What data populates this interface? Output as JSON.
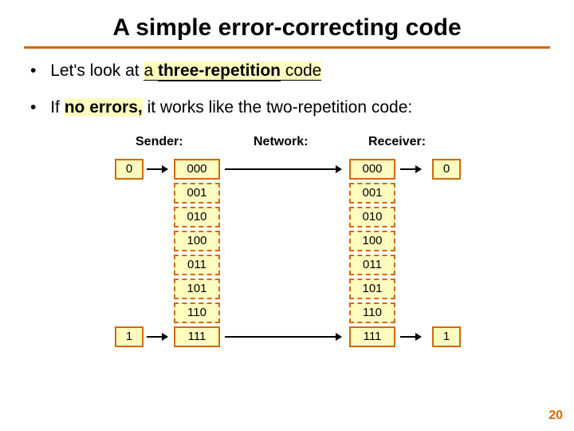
{
  "title": "A simple error-correcting code",
  "bullets": {
    "b1_pre": "Let's look at ",
    "b1_a": "a ",
    "b1_u": "three-repetition",
    "b1_post": " code",
    "b2_pre": "If ",
    "b2_no_errors": "no errors,",
    "b2_post": " it works like the two-repetition code:"
  },
  "headers": {
    "sender": "Sender:",
    "network": "Network:",
    "receiver": "Receiver:"
  },
  "bits": {
    "sender_top": "0",
    "sender_bot": "1",
    "recv_top": "0",
    "recv_bot": "1"
  },
  "codes": [
    "000",
    "001",
    "010",
    "100",
    "011",
    "101",
    "110",
    "111"
  ],
  "page": "20"
}
